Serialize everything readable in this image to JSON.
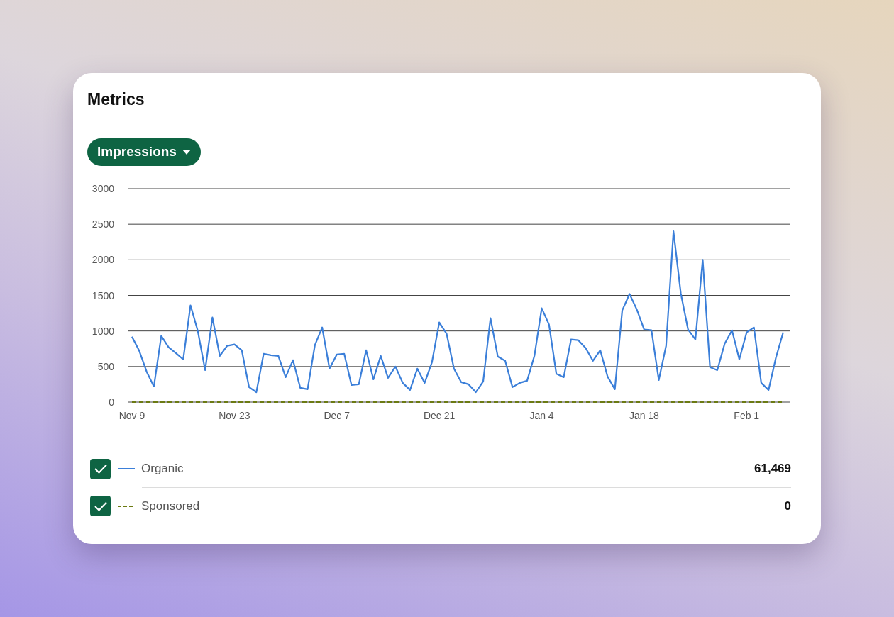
{
  "card": {
    "title": "Metrics"
  },
  "metric_button": {
    "label": "Impressions"
  },
  "chart_data": {
    "type": "line",
    "categories": [
      "Nov 9",
      null,
      null,
      null,
      null,
      null,
      null,
      null,
      null,
      null,
      null,
      null,
      null,
      null,
      "Nov 23",
      null,
      null,
      null,
      null,
      null,
      null,
      null,
      null,
      null,
      null,
      null,
      null,
      null,
      "Dec 7",
      null,
      null,
      null,
      null,
      null,
      null,
      null,
      null,
      null,
      null,
      null,
      null,
      null,
      "Dec 21",
      null,
      null,
      null,
      null,
      null,
      null,
      null,
      null,
      null,
      null,
      null,
      null,
      null,
      "Jan 4",
      null,
      null,
      null,
      null,
      null,
      null,
      null,
      null,
      null,
      null,
      null,
      null,
      null,
      "Jan 18",
      null,
      null,
      null,
      null,
      null,
      null,
      null,
      null,
      null,
      null,
      null,
      null,
      null,
      "Feb 1",
      null,
      null,
      null,
      null,
      null
    ],
    "ylim": [
      0,
      3000
    ],
    "grid": true,
    "yticks": [
      0,
      500,
      1000,
      1500,
      2000,
      2500,
      3000
    ],
    "series": [
      {
        "name": "Organic",
        "color": "#3b7fd9",
        "line_style": "solid",
        "values": [
          920,
          720,
          430,
          220,
          930,
          770,
          690,
          600,
          1360,
          1000,
          450,
          1190,
          650,
          790,
          810,
          730,
          210,
          140,
          680,
          660,
          650,
          350,
          590,
          200,
          180,
          800,
          1050,
          470,
          670,
          680,
          240,
          250,
          730,
          320,
          650,
          340,
          500,
          270,
          170,
          470,
          270,
          560,
          1120,
          960,
          470,
          280,
          250,
          140,
          290,
          1180,
          640,
          580,
          210,
          270,
          300,
          650,
          1320,
          1090,
          400,
          350,
          880,
          870,
          760,
          580,
          730,
          360,
          180,
          1290,
          1520,
          1300,
          1020,
          1010,
          310,
          790,
          2400,
          1530,
          1020,
          880,
          2000,
          490,
          450,
          820,
          1010,
          600,
          980,
          1050,
          270,
          170,
          620,
          980
        ]
      },
      {
        "name": "Sponsored",
        "color": "#6b7a12",
        "line_style": "dashed",
        "values": [
          0,
          0,
          0,
          0,
          0,
          0,
          0,
          0,
          0,
          0,
          0,
          0,
          0,
          0,
          0,
          0,
          0,
          0,
          0,
          0,
          0,
          0,
          0,
          0,
          0,
          0,
          0,
          0,
          0,
          0,
          0,
          0,
          0,
          0,
          0,
          0,
          0,
          0,
          0,
          0,
          0,
          0,
          0,
          0,
          0,
          0,
          0,
          0,
          0,
          0,
          0,
          0,
          0,
          0,
          0,
          0,
          0,
          0,
          0,
          0,
          0,
          0,
          0,
          0,
          0,
          0,
          0,
          0,
          0,
          0,
          0,
          0,
          0,
          0,
          0,
          0,
          0,
          0,
          0,
          0,
          0,
          0,
          0,
          0,
          0,
          0,
          0,
          0,
          0,
          0
        ]
      }
    ]
  },
  "legend": [
    {
      "total": "61,469",
      "checked": true
    },
    {
      "total": "0",
      "checked": true
    }
  ]
}
